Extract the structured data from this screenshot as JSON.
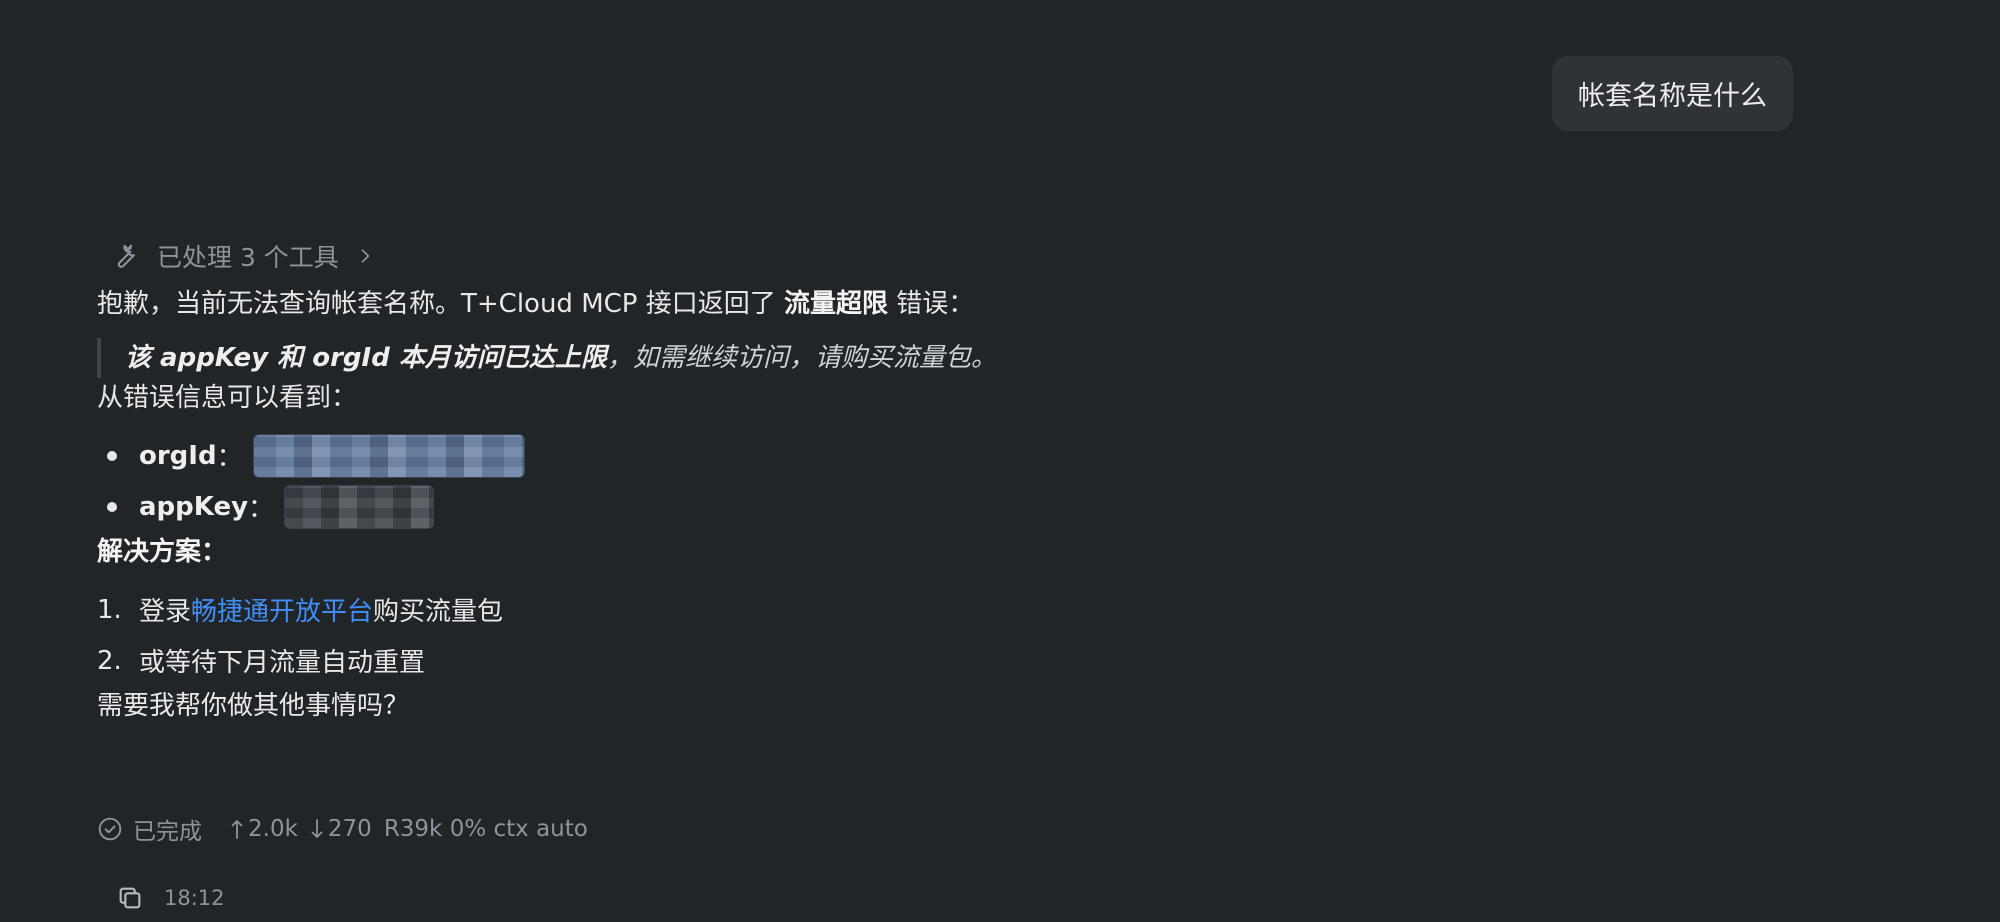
{
  "user_message": "帐套名称是什么",
  "tools": {
    "label": "已处理 3 个工具",
    "icon": "wrench-icon",
    "chevron_icon": "chevron-right-icon"
  },
  "reply": {
    "intro_prefix": "抱歉，当前无法查询帐套名称。T+Cloud MCP 接口返回了 ",
    "intro_bold": "流量超限",
    "intro_suffix": " 错误：",
    "quote_bold": "该 appKey 和 orgId 本月访问已达上限",
    "quote_rest": "，如需继续访问，请购买流量包。",
    "info_line": "从错误信息可以看到：",
    "bullets": [
      {
        "key": "orgId",
        "sep": "："
      },
      {
        "key": "appKey",
        "sep": "："
      }
    ],
    "solution_heading": "解决方案：",
    "steps": [
      {
        "num": "1.",
        "prefix": "登录 ",
        "link": "畅捷通开放平台",
        "suffix": " 购买流量包"
      },
      {
        "num": "2.",
        "text": "或等待下月流量自动重置"
      }
    ],
    "closing": "需要我帮你做其他事情吗？"
  },
  "status": {
    "done_label": "已完成",
    "up_value": "2.0k",
    "down_value": "270",
    "rest": "R39k 0% ctx auto"
  },
  "footer": {
    "time": "18:12"
  },
  "colors": {
    "background": "#222528",
    "bubble": "#2f3236",
    "link": "#3f8ef5",
    "muted": "#8f9399"
  }
}
